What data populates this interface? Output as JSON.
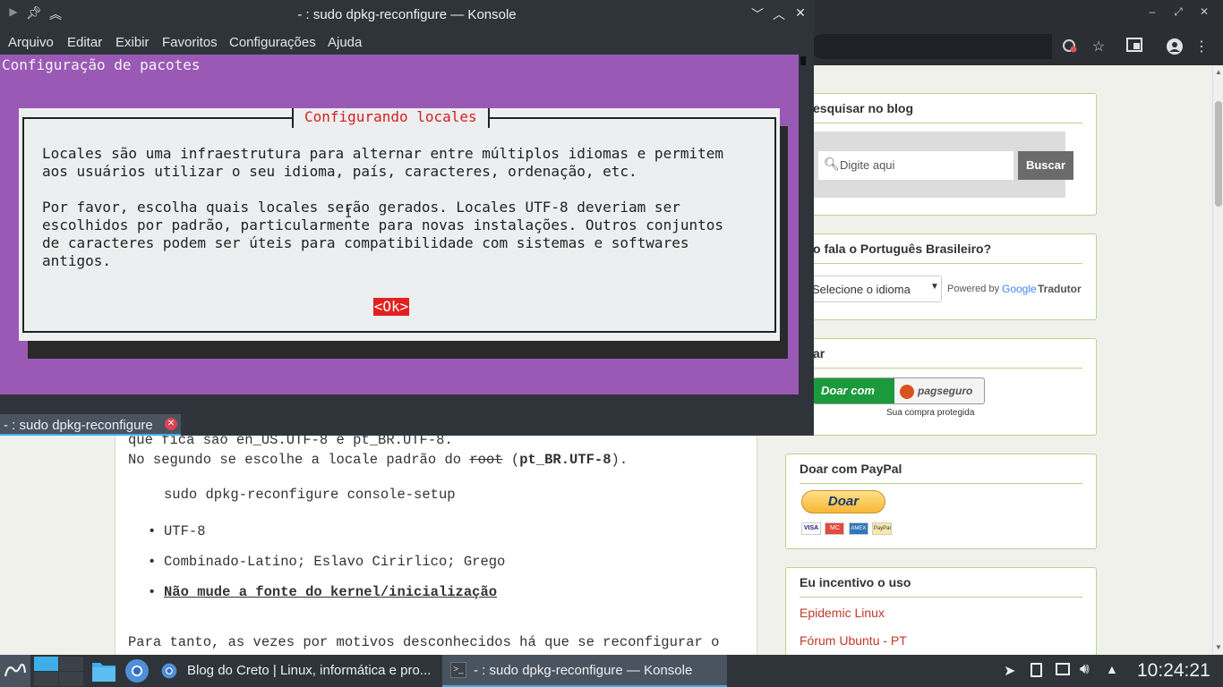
{
  "browser": {
    "win_controls": [
      "–",
      "⤢",
      "✕"
    ],
    "toolbar_icons": [
      "extension-off-icon",
      "star-icon",
      "cast-icon",
      "account-icon",
      "menu-icon"
    ]
  },
  "article": {
    "line_partial": "que fica são en_US.UTF-8 e pt_BR.UTF-8.",
    "line2_prefix": "No segundo se escolhe a locale padrão do ",
    "line2_root": "root",
    "line2_mid": " (",
    "line2_locale": "pt_BR.UTF-8",
    "line2_end": ").",
    "command": "sudo dpkg-reconfigure console-setup",
    "bullets": [
      "UTF-8",
      "Combinado-Latino; Eslavo Cirirlico; Grego",
      "Não mude a fonte do kernel/inicialização"
    ],
    "para": "Para tanto, as vezes por motivos desconhecidos há que se reconfigurar o"
  },
  "sidebar": {
    "search": {
      "title": "Pesquisar no blog",
      "title_visible": "esquisar no blog",
      "placeholder": "Digite aqui",
      "button": "Buscar"
    },
    "translate": {
      "title_visible": "o fala o Português Brasileiro?",
      "select": "Selecione o idioma",
      "powered_by": "Powered by",
      "google": "Google",
      "tradutor": "Tradutor"
    },
    "donate": {
      "title_visible": "ar",
      "button_left": "Doar com",
      "brand": "pagseguro",
      "subtitle": "Sua compra protegida"
    },
    "paypal": {
      "title": "Doar com PayPal",
      "button": "Doar",
      "cards": [
        "VISA",
        "MC",
        "AMEX",
        "PayPal"
      ]
    },
    "links": {
      "title": "Eu incentivo o uso",
      "items": [
        "Epidemic Linux",
        "Fórum Ubuntu - PT"
      ]
    }
  },
  "konsole": {
    "title": "- : sudo dpkg-reconfigure — Konsole",
    "menu": [
      "Arquivo",
      "Editar",
      "Exibir",
      "Favoritos",
      "Configurações",
      "Ajuda"
    ],
    "tab_label": "- : sudo dpkg-reconfigure",
    "term_header": "Configuração de pacotes",
    "dialog": {
      "title": "Configurando locales",
      "lines": [
        "Locales são uma infraestrutura para alternar entre múltiplos idiomas e permitem",
        "aos usuários utilizar o seu idioma, país, caracteres, ordenação, etc.",
        "",
        "Por favor, escolha quais locales serão gerados. Locales UTF-8 deveriam ser",
        "escolhidos por padrão, particularmente para novas instalações. Outros conjuntos",
        "de caracteres podem ser úteis para compatibilidade com sistemas e softwares",
        "antigos."
      ],
      "ok": "<Ok>"
    },
    "colors": {
      "terminal_bg": "#9b59b6",
      "accent": "#e2201f"
    }
  },
  "taskbar": {
    "tasks": [
      {
        "label": "Blog do Creto | Linux, informática e pro..."
      },
      {
        "label": "- : sudo dpkg-reconfigure — Konsole"
      }
    ],
    "clock": "10:24:21"
  }
}
